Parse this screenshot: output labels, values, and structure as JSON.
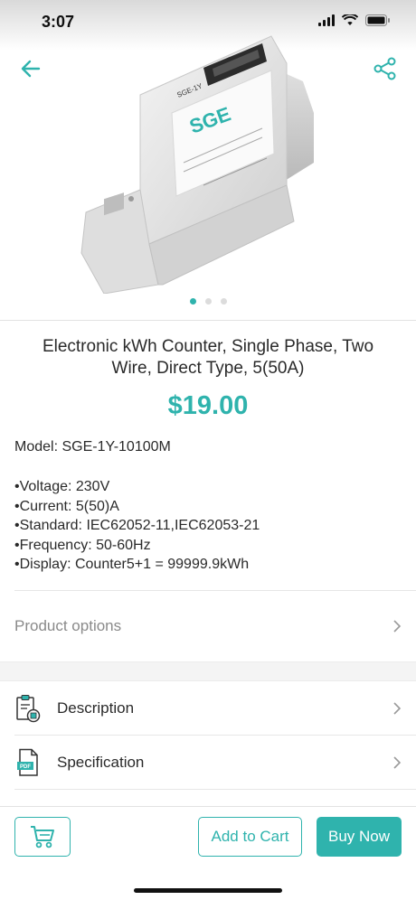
{
  "status_bar": {
    "time": "3:07"
  },
  "product": {
    "brand_mark": "SGE",
    "model_mark": "SGE-1Y",
    "title": "Electronic kWh Counter, Single Phase, Two Wire, Direct Type, 5(50A)",
    "price": "$19.00",
    "model": "Model: SGE-1Y-10100M",
    "specs": [
      "Voltage: 230V",
      "Current: 5(50)A",
      "Standard: IEC62052-11,IEC62053-21",
      "Frequency: 50-60Hz",
      "Display: Counter5+1 = 99999.9kWh"
    ]
  },
  "carousel": {
    "total": 3,
    "active_index": 0
  },
  "options": {
    "label": "Product options"
  },
  "menu": [
    {
      "label": "Description",
      "icon": "clipboard-box-icon"
    },
    {
      "label": "Specification",
      "icon": "pdf-document-icon"
    },
    {
      "label": "",
      "icon": "document-icon"
    }
  ],
  "actions": {
    "cart_icon": "shopping-cart-icon",
    "add_to_cart": "Add to Cart",
    "buy_now": "Buy Now"
  },
  "colors": {
    "accent": "#2fb3ad",
    "text": "#2a2a2a",
    "muted": "#8a8a8a"
  }
}
